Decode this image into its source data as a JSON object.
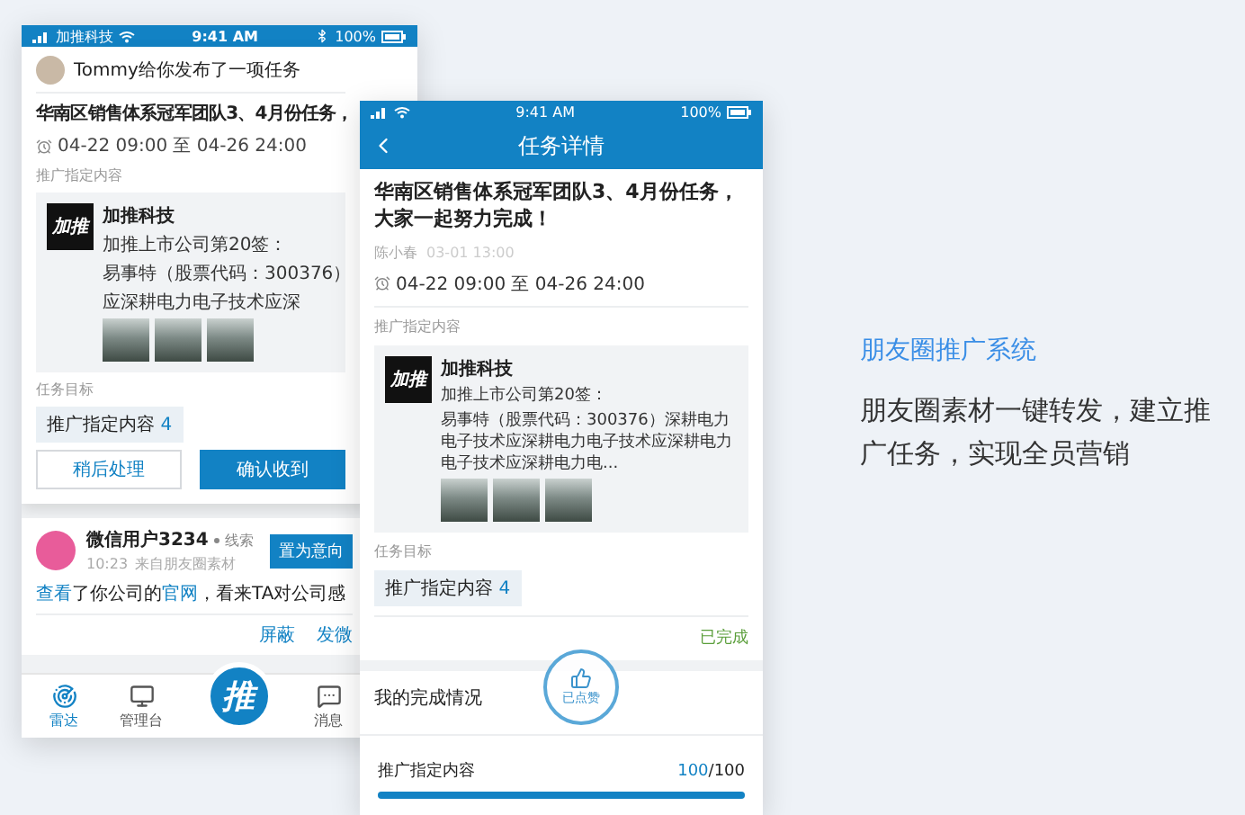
{
  "back_phone": {
    "status_bar": {
      "carrier": "加推科技",
      "time": "9:41 AM",
      "battery": "100%"
    },
    "notification": {
      "sender": "Tommy给你发布了一项任务",
      "title": "华南区销售体系冠军团队3、4月份任务，",
      "period": "04-22 09:00 至 04-26 24:00",
      "content_label": "推广指定内容",
      "post": {
        "logo": "加推",
        "name": "加推科技",
        "lines": [
          "加推上市公司第20签：",
          "易事特（股票代码：300376）",
          "应深耕电力电子技术应深"
        ]
      },
      "goal_label": "任务目标",
      "goal": {
        "label": "推广指定内容",
        "count": "4"
      },
      "buttons": [
        {
          "label": "稍后处理",
          "kind": "secondary"
        },
        {
          "label": "确认收到",
          "kind": "primary"
        }
      ]
    },
    "lead": {
      "name": "微信用户3234",
      "tag": "线索",
      "time": "10:23",
      "source": "来自朋友圈素材",
      "action": "置为意向",
      "message": [
        {
          "text": "查看",
          "link": true
        },
        {
          "text": "了你公司的",
          "link": false
        },
        {
          "text": "官网",
          "link": true
        },
        {
          "text": "，看来TA对公司感",
          "link": false
        }
      ],
      "buttons": [
        "屏蔽",
        "发微"
      ]
    },
    "nav": [
      {
        "label": "雷达",
        "kind": "radar",
        "selected": true
      },
      {
        "label": "管理台",
        "kind": "desk",
        "selected": false
      },
      {
        "label": "推",
        "kind": "center",
        "selected": false
      },
      {
        "label": "消息",
        "kind": "message",
        "selected": false
      }
    ]
  },
  "front_phone": {
    "status_bar": {
      "time": "9:41 AM",
      "battery": "100%"
    },
    "title": "任务详情",
    "task": {
      "title": "华南区销售体系冠军团队3、4月份任务，大家一起努力完成！",
      "author": "陈小春",
      "date": "03-01 13:00",
      "period": "04-22 09:00 至 04-26 24:00",
      "content_label": "推广指定内容",
      "post": {
        "logo": "加推",
        "name": "加推科技",
        "lines": [
          "加推上市公司第20签：",
          "易事特（股票代码：300376）深耕电力电子技术应深耕电力电子技术应深耕电力电子技术应深耕电力电..."
        ]
      },
      "goal_label": "任务目标",
      "goal": {
        "label": "推广指定内容",
        "count": "4"
      },
      "status": {
        "label": "已完成",
        "kind": "done"
      }
    },
    "progress": {
      "heading": "我的完成情况",
      "stamp": "已点赞",
      "rows": [
        {
          "label": "推广指定内容",
          "done": "100",
          "total": "/100",
          "level": 1
        }
      ]
    }
  },
  "feature": {
    "title": "朋友圈推广系统",
    "description": "朋友圈素材一键转发，建立推广任务，实现全员营销"
  }
}
